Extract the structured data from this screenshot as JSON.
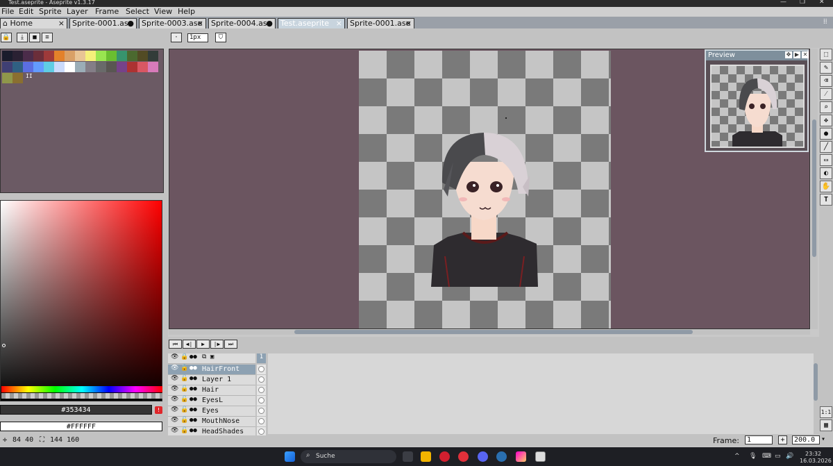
{
  "window": {
    "title": "Test.aseprite - Aseprite v1.3.17"
  },
  "menu": [
    "File",
    "Edit",
    "Sprite",
    "Layer",
    "Frame",
    "Select",
    "View",
    "Help"
  ],
  "tabs": [
    {
      "label": "Home",
      "close": "×"
    },
    {
      "label": "Sprite-0001.ase",
      "close": "●"
    },
    {
      "label": "Sprite-0003.ase",
      "close": "×"
    },
    {
      "label": "Sprite-0004.ase",
      "close": "●"
    },
    {
      "label": "Test.aseprite",
      "close": "×"
    },
    {
      "label": "Sprite-0001.ase",
      "close": "×"
    }
  ],
  "context_bar": {
    "brush_size": "1px"
  },
  "palette": {
    "colors": [
      "#1a1c2c",
      "#2a2133",
      "#4b2c4a",
      "#6b2e3a",
      "#9e3a3a",
      "#e3812a",
      "#d9a066",
      "#e8c495",
      "#f4f07a",
      "#99e550",
      "#6abe30",
      "#37946e",
      "#4b692f",
      "#524b24",
      "#323c39",
      "#3f3f74",
      "#306082",
      "#5b6ee1",
      "#639bff",
      "#5fcde4",
      "#cbdbfc",
      "#ffffff",
      "#9badb7",
      "#847e87",
      "#696a6a",
      "#595652",
      "#76428a",
      "#ac3232",
      "#d95763",
      "#d77bba",
      "#8f974a",
      "#8a6f30"
    ],
    "overflow_mark": "II"
  },
  "colors": {
    "foreground": "#353434",
    "background": "#FFFFFF"
  },
  "preview": {
    "title": "Preview"
  },
  "timeline": {
    "frame_header": "1",
    "layers": [
      {
        "name": "HairFront",
        "selected": true
      },
      {
        "name": "Layer 1",
        "selected": false
      },
      {
        "name": "Hair",
        "selected": false
      },
      {
        "name": "EyesL",
        "selected": false
      },
      {
        "name": "Eyes",
        "selected": false
      },
      {
        "name": "MouthNose",
        "selected": false
      },
      {
        "name": "HeadShades",
        "selected": false
      }
    ]
  },
  "status": {
    "cursor_pos": "84 40",
    "sprite_size": "144 160",
    "frame_label": "Frame:",
    "frame_value": "1",
    "zoom": "200.0"
  },
  "tools": [
    "rect-marquee-icon",
    "pencil-icon",
    "eraser-icon",
    "eyedropper-icon",
    "zoom-icon",
    "move-icon",
    "fill-icon",
    "line-icon",
    "rectangle-icon",
    "blur-icon",
    "smudge-icon",
    "text-icon"
  ],
  "taskbar": {
    "search_label": "Suche",
    "time": "23:32",
    "date": "16.03.2026"
  },
  "sidebar_buttons": {
    "fit": "1:1"
  }
}
